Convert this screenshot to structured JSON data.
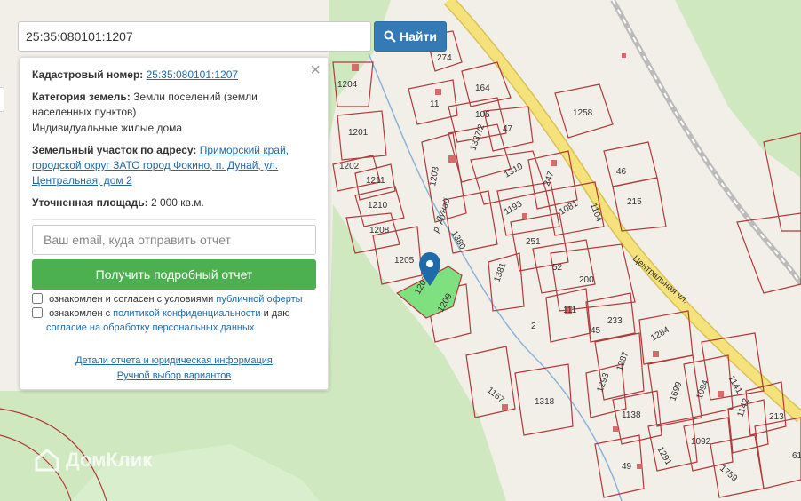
{
  "search": {
    "value": "25:35:080101:1207",
    "button_label": "Найти"
  },
  "panel": {
    "cadastral_label": "Кадастровый номер:",
    "cadastral_value": "25:35:080101:1207",
    "category_label": "Категория земель:",
    "category_value": "Земли поселений (земли населенных пунктов)",
    "category_use": "Индивидуальные жилые дома",
    "address_label": "Земельный участок по адресу:",
    "address_value": "Приморский край, городской округ ЗАТО город Фокино, п. Дунай, ул. Центральная, дом 2",
    "area_label": "Уточненная площадь:",
    "area_value": "2 000 кв.м.",
    "email_placeholder": "Ваш email, куда отправить отчет",
    "report_button": "Получить подробный отчет",
    "consent1_text": "ознакомлен и согласен с условиями",
    "consent1_link": "публичной оферты",
    "consent2_text": "ознакомлен с",
    "consent2_link": "политикой конфиденциальности",
    "consent2_and": "и даю",
    "consent2_link2": "согласие на обработку персональных данных",
    "details_link": "Детали отчета и юридическая информация",
    "manual_link": "Ручной выбор вариантов",
    "close_symbol": "×"
  },
  "map": {
    "street_label": "Центральная ул.",
    "river_label": "р. Дунай",
    "selected_parcel": "1207",
    "parcel_labels": [
      "1204",
      "274",
      "164",
      "11",
      "105",
      "47",
      "1258",
      "1201",
      "1337/2",
      "1202",
      "1211",
      "1203",
      "1310",
      "247",
      "46",
      "1210",
      "1193",
      "1104",
      "215",
      "1208",
      "1380",
      "1081",
      "251",
      "1205",
      "52",
      "1381",
      "200",
      "1209",
      "111",
      "233",
      "2",
      "45",
      "1284",
      "1167",
      "1287",
      "1141",
      "1293",
      "1699",
      "1094",
      "1318",
      "1138",
      "213",
      "1142",
      "1092",
      "1291",
      "1759",
      "49",
      "61"
    ],
    "watermark": "ДомКлик",
    "colors": {
      "parcel_border": "#b03a3a",
      "selected_fill": "#7ee07e",
      "forest": "#cfe8c0",
      "road": "#f5e27a",
      "pin": "#1f6aa8"
    }
  }
}
